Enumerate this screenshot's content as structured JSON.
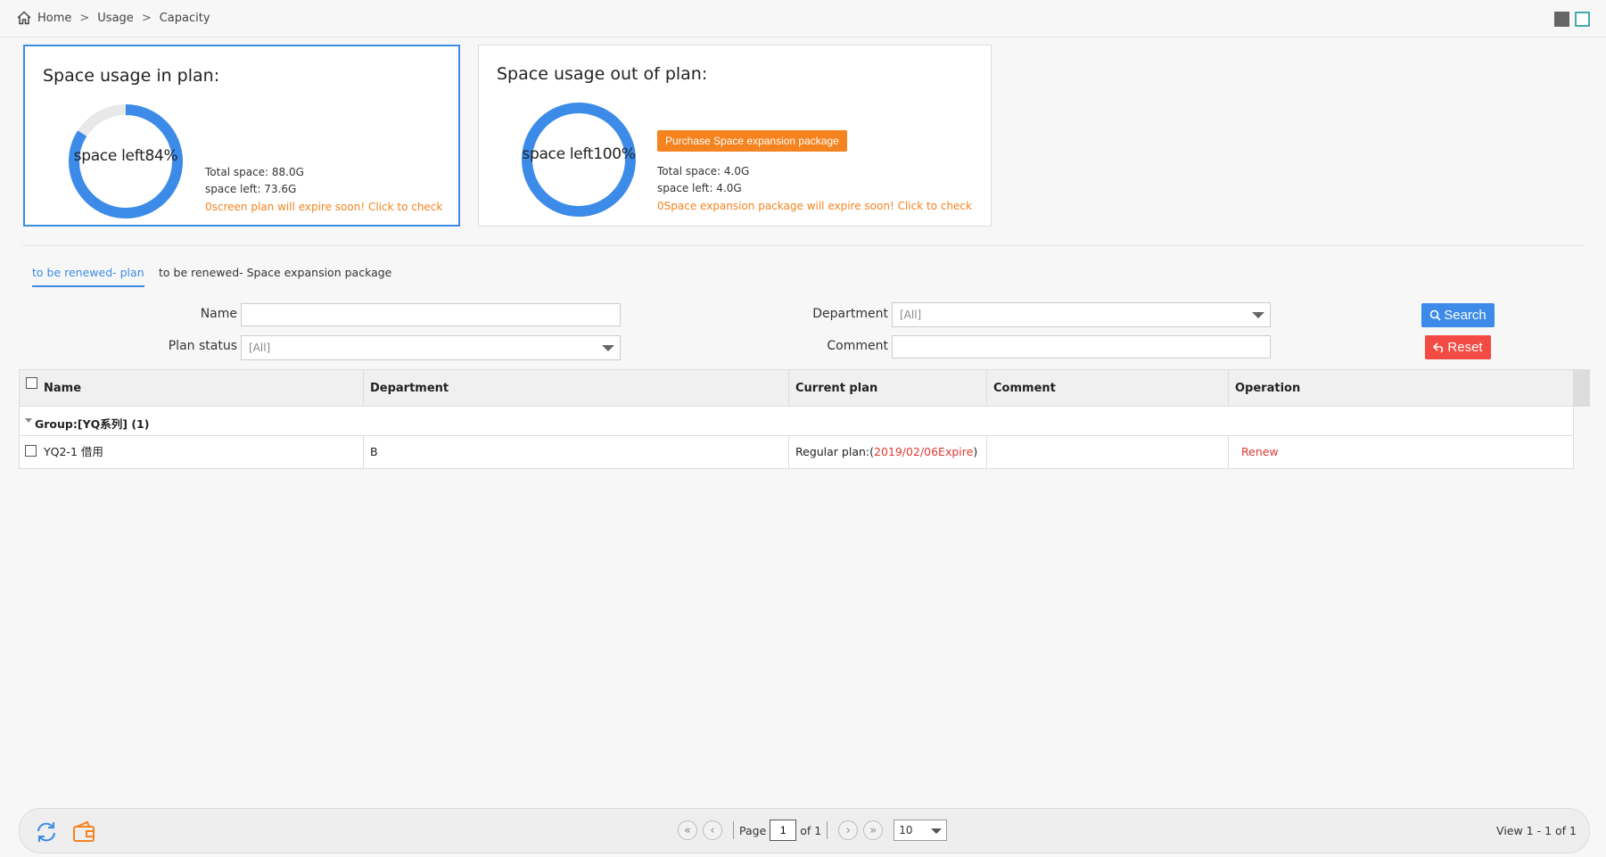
{
  "breadcrumb": {
    "home": "Home",
    "sep": ">",
    "usage": "Usage",
    "capacity": "Capacity"
  },
  "card_in_plan": {
    "title": "Space usage in plan:",
    "donut_label": "space left84%",
    "percent_left": 84,
    "total": "Total space: 88.0G",
    "left": "space left: 73.6G",
    "warning": "0screen plan will expire soon! Click to check"
  },
  "card_out_plan": {
    "title": "Space usage out of plan:",
    "donut_label": "space left100%",
    "percent_left": 100,
    "purchase_label": "Purchase Space expansion package",
    "total": "Total space: 4.0G",
    "left": "space left: 4.0G",
    "warning": "0Space expansion package will expire soon! Click to check"
  },
  "tabs": [
    {
      "label": "to be renewed- plan",
      "active": true
    },
    {
      "label": "to be renewed- Space expansion package",
      "active": false
    }
  ],
  "filters": {
    "name_label": "Name",
    "name_value": "",
    "plan_status_label": "Plan status",
    "plan_status_value": "[All]",
    "department_label": "Department",
    "department_value": "[All]",
    "comment_label": "Comment",
    "comment_value": "",
    "search_label": "Search",
    "reset_label": "Reset"
  },
  "table": {
    "columns": [
      "Name",
      "Department",
      "Current plan",
      "Comment",
      "Operation"
    ],
    "group_label": "Group:[YQ系列] (1)",
    "rows": [
      {
        "name": "YQ2-1 借用",
        "department": "B",
        "plan_prefix": "Regular plan:(",
        "plan_date": "2019/02/06Expire",
        "plan_suffix": ")",
        "comment": "",
        "operation": "Renew"
      }
    ]
  },
  "footer": {
    "page_label": "Page",
    "page_value": "1",
    "of_label": "of 1",
    "page_size": "10",
    "view_info": "View 1 - 1 of 1"
  },
  "colors": {
    "accent": "#3c8be8",
    "orange": "#f5831f",
    "danger": "#f24b43",
    "donut_track": "#e8e8e8"
  },
  "icons": [
    "home-icon",
    "refresh-icon",
    "wallet-icon",
    "search-icon",
    "reset-icon",
    "first-page-icon",
    "prev-page-icon",
    "next-page-icon",
    "last-page-icon"
  ]
}
